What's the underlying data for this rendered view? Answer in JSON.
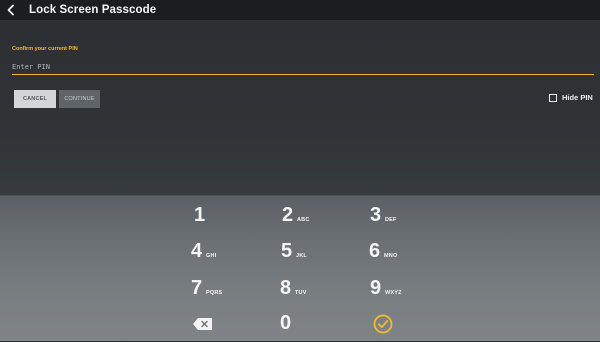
{
  "header": {
    "title": "Lock Screen Passcode",
    "back_icon": "back-arrow-icon"
  },
  "form": {
    "prompt": "Confirm your current PIN",
    "pin_value": "",
    "pin_placeholder": "Enter PIN",
    "cancel_label": "CANCEL",
    "continue_label": "CONTINUE",
    "hide_pin_label": "Hide PIN",
    "hide_pin_checked": false
  },
  "keypad": {
    "keys": [
      {
        "digit": "1",
        "letters": ""
      },
      {
        "digit": "2",
        "letters": "ABC"
      },
      {
        "digit": "3",
        "letters": "DEF"
      },
      {
        "digit": "4",
        "letters": "GHI"
      },
      {
        "digit": "5",
        "letters": "JKL"
      },
      {
        "digit": "6",
        "letters": "MNO"
      },
      {
        "digit": "7",
        "letters": "PQRS"
      },
      {
        "digit": "8",
        "letters": "TUV"
      },
      {
        "digit": "9",
        "letters": "WXYZ"
      },
      {
        "digit": "0",
        "letters": ""
      }
    ],
    "backspace_icon": "backspace-icon",
    "confirm_icon": "checkmark-circle-icon"
  },
  "colors": {
    "accent": "#f5b82e",
    "header_bg": "#1b1e20",
    "content_bg": "#2f3336",
    "keypad_bg": "#6a6f73"
  }
}
